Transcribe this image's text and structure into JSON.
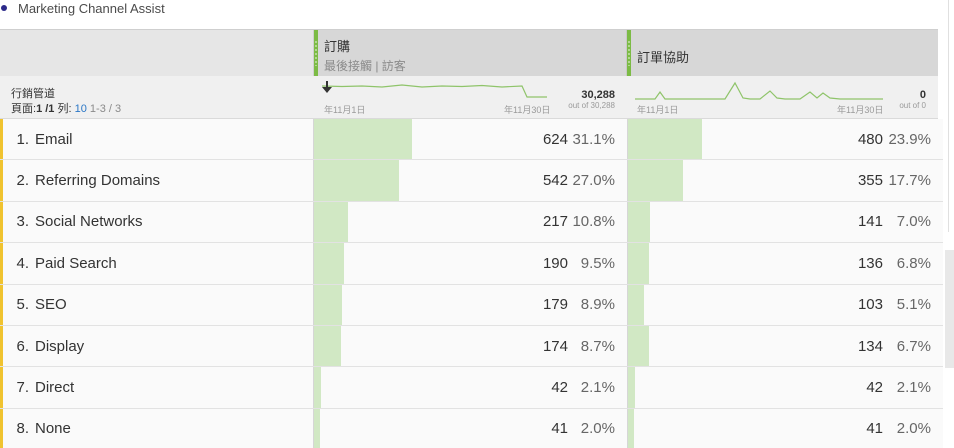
{
  "panel": {
    "title": "Marketing Channel Assist"
  },
  "columns": [
    {
      "name": "訂購",
      "subtitle": "最後接觸 | 訪客",
      "start_date": "年11月1日",
      "end_date": "年11月30日",
      "total": "30,288",
      "out_of": "out of 30,288"
    },
    {
      "name": "訂單協助",
      "subtitle": "",
      "start_date": "年11月1日",
      "end_date": "年11月30日",
      "total": "0",
      "out_of": "out of 0"
    }
  ],
  "dimension": {
    "title": "行銷管道",
    "page_label": "頁面:",
    "page_value": "1 /1",
    "rows_label": "列:",
    "rows_value": "10",
    "range": "1-3 / 3"
  },
  "rows": [
    {
      "rank": "1.",
      "name": "Email",
      "v1": "624",
      "p1": "31.1%",
      "f1": 0.311,
      "v2": "480",
      "p2": "23.9%",
      "f2": 0.239
    },
    {
      "rank": "2.",
      "name": "Referring Domains",
      "v1": "542",
      "p1": "27.0%",
      "f1": 0.27,
      "v2": "355",
      "p2": "17.7%",
      "f2": 0.177
    },
    {
      "rank": "3.",
      "name": "Social Networks",
      "v1": "217",
      "p1": "10.8%",
      "f1": 0.108,
      "v2": "141",
      "p2": "7.0%",
      "f2": 0.07
    },
    {
      "rank": "4.",
      "name": "Paid Search",
      "v1": "190",
      "p1": "9.5%",
      "f1": 0.095,
      "v2": "136",
      "p2": "6.8%",
      "f2": 0.068
    },
    {
      "rank": "5.",
      "name": "SEO",
      "v1": "179",
      "p1": "8.9%",
      "f1": 0.089,
      "v2": "103",
      "p2": "5.1%",
      "f2": 0.051
    },
    {
      "rank": "6.",
      "name": "Display",
      "v1": "174",
      "p1": "8.7%",
      "f1": 0.087,
      "v2": "134",
      "p2": "6.7%",
      "f2": 0.067
    },
    {
      "rank": "7.",
      "name": "Direct",
      "v1": "42",
      "p1": "2.1%",
      "f1": 0.021,
      "v2": "42",
      "p2": "2.1%",
      "f2": 0.021
    },
    {
      "rank": "8.",
      "name": "None",
      "v1": "41",
      "p1": "2.0%",
      "f1": 0.02,
      "v2": "41",
      "p2": "2.0%",
      "f2": 0.02
    }
  ],
  "colors": {
    "accent_green": "#7cbb45",
    "bar_fill": "#d1e8c4",
    "row_marker": "#f0c330",
    "sparkline": "#8fc46a"
  }
}
